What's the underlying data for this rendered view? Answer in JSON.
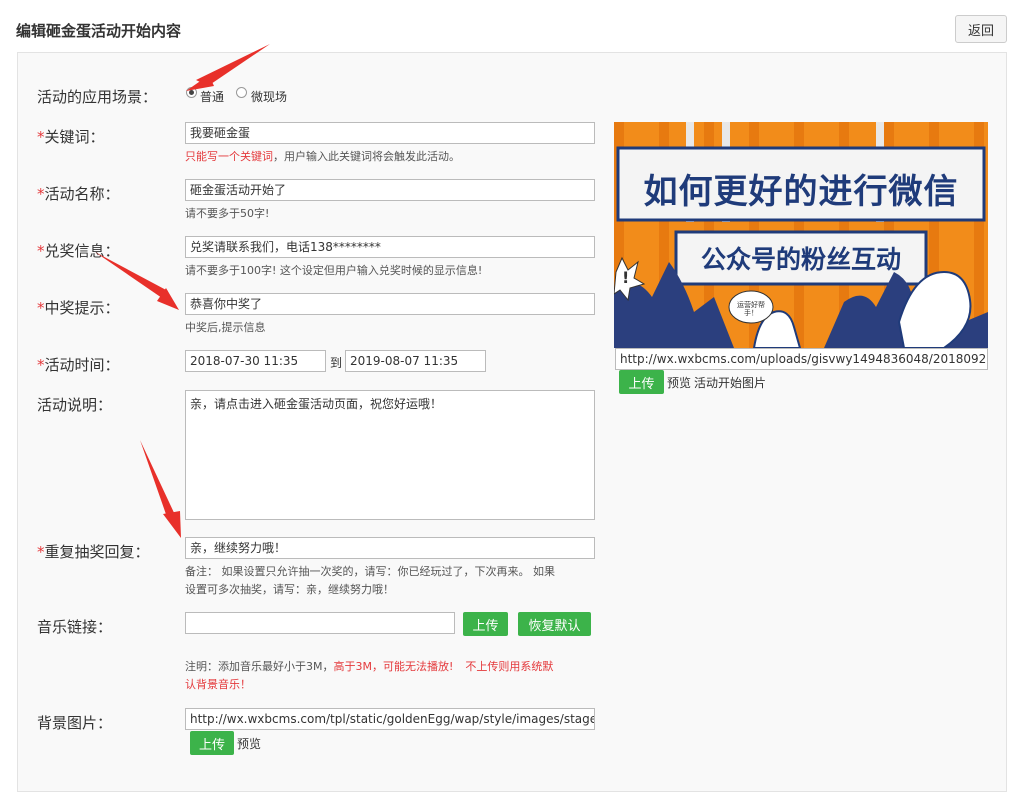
{
  "header": {
    "title": "编辑砸金蛋活动开始内容",
    "back_label": "返回"
  },
  "scene": {
    "label": "活动的应用场景：",
    "option1": "普通",
    "option2": "微现场"
  },
  "keyword": {
    "label": "关键词：",
    "value": "我要砸金蛋",
    "hint_red": "只能写一个关键词",
    "hint_rest": "，用户输入此关键词将会触发此活动。"
  },
  "name": {
    "label": "活动名称：",
    "value": "砸金蛋活动开始了",
    "hint": "请不要多于50字!"
  },
  "prize_info": {
    "label": "兑奖信息：",
    "value": "兑奖请联系我们，电话138********",
    "hint": "请不要多于100字! 这个设定但用户输入兑奖时候的显示信息!"
  },
  "win_tip": {
    "label": "中奖提示：",
    "value": "恭喜你中奖了",
    "hint": "中奖后,提示信息"
  },
  "time": {
    "label": "活动时间：",
    "start": "2018-07-30 11:35",
    "to": "到",
    "end": "2019-08-07 11:35"
  },
  "desc": {
    "label": "活动说明：",
    "value": "亲，请点击进入砸金蛋活动页面，祝您好运哦！"
  },
  "repeat": {
    "label": "重复抽奖回复：",
    "value": "亲，继续努力哦！",
    "hint1": "备注： 如果设置只允许抽一次奖的，请写：你已经玩过了，下次再来。 如果",
    "hint2": "设置可多次抽奖，请写：亲，继续努力哦！"
  },
  "music": {
    "label": "音乐链接：",
    "value": "",
    "upload": "上传",
    "reset": "恢复默认",
    "note_black": "注明：添加音乐最好小于3M，",
    "note_red1": "高于3M，可能无法播放!",
    "note_red2": "不上传则用系统默",
    "note_red3": "认背景音乐！"
  },
  "bg": {
    "label": "背景图片：",
    "value": "http://wx.wxbcms.com/tpl/static/goldenEgg/wap/style/images/stage.j",
    "upload": "上传",
    "preview": "预览"
  },
  "start_image": {
    "url": "http://wx.wxbcms.com/uploads/gisvwy1494836048/20180922/1",
    "upload": "上传",
    "preview": "预览",
    "label": "活动开始图片",
    "poster_line1": "如何更好的进行微信",
    "poster_line2": "公众号的粉丝互动",
    "poster_bubble": "运营好帮手！",
    "poster_exclaim": "!"
  },
  "colors": {
    "green": "#3cb34a",
    "red": "#e4393c",
    "poster_orange": "#f28c1a",
    "poster_navy": "#1f3b7a"
  }
}
